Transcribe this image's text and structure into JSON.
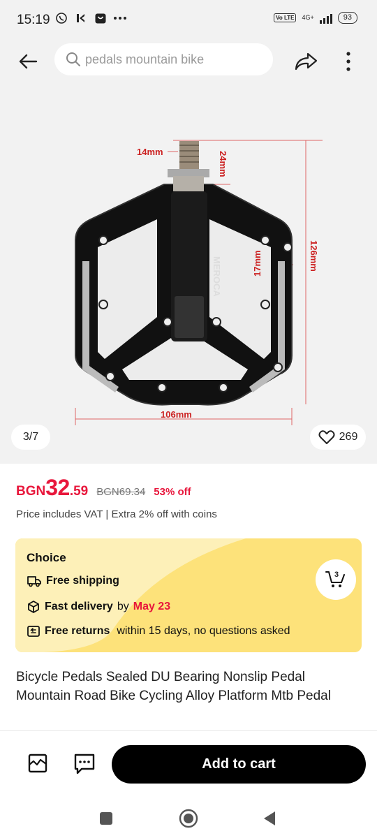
{
  "status_bar": {
    "time": "15:19",
    "network": "4G+",
    "volte": "Vo LTE",
    "battery": "93"
  },
  "header": {
    "search_placeholder": "pedals mountain bike"
  },
  "gallery": {
    "counter": "3/7",
    "likes": "269",
    "dimensions": {
      "thread_width": "14mm",
      "thread_length": "24mm",
      "thickness": "17mm",
      "length": "126mm",
      "width": "106mm"
    },
    "brand": "MEROCA"
  },
  "price": {
    "currency": "BGN",
    "integer": "32",
    "decimal": ".59",
    "original": "BGN69.34",
    "discount": "53% off",
    "vat_note": "Price includes VAT | Extra 2% off with coins"
  },
  "choice": {
    "title": "Choice",
    "shipping": "Free shipping",
    "delivery_label": "Fast delivery",
    "delivery_by": "by",
    "delivery_date": "May 23",
    "returns_label": "Free returns",
    "returns_note": "within 15 days, no questions asked",
    "cart_count": "3",
    "colors": {
      "card": "#fde27a",
      "accent": "#e8173c"
    }
  },
  "product": {
    "title": "Bicycle Pedals Sealed DU Bearing Nonslip Pedal Mountain Road Bike Cycling Alloy Platform Mtb Pedal"
  },
  "bottom_bar": {
    "add_to_cart": "Add to cart"
  }
}
